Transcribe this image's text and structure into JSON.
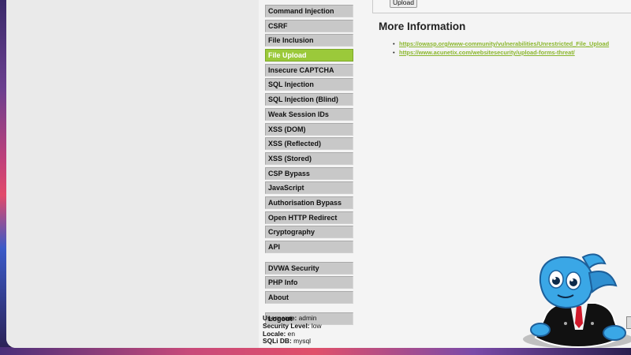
{
  "menu": {
    "group1": [
      {
        "label": "Command Injection",
        "selected": false
      },
      {
        "label": "CSRF",
        "selected": false
      },
      {
        "label": "File Inclusion",
        "selected": false
      },
      {
        "label": "File Upload",
        "selected": true
      },
      {
        "label": "Insecure CAPTCHA",
        "selected": false
      },
      {
        "label": "SQL Injection",
        "selected": false
      },
      {
        "label": "SQL Injection (Blind)",
        "selected": false
      },
      {
        "label": "Weak Session IDs",
        "selected": false
      },
      {
        "label": "XSS (DOM)",
        "selected": false
      },
      {
        "label": "XSS (Reflected)",
        "selected": false
      },
      {
        "label": "XSS (Stored)",
        "selected": false
      },
      {
        "label": "CSP Bypass",
        "selected": false
      },
      {
        "label": "JavaScript",
        "selected": false
      },
      {
        "label": "Authorisation Bypass",
        "selected": false
      },
      {
        "label": "Open HTTP Redirect",
        "selected": false
      },
      {
        "label": "Cryptography",
        "selected": false
      },
      {
        "label": "API",
        "selected": false
      }
    ],
    "group2": [
      {
        "label": "DVWA Security"
      },
      {
        "label": "PHP Info"
      },
      {
        "label": "About"
      }
    ],
    "logout": "Logout"
  },
  "userinfo": {
    "username_label": "Username:",
    "username": "admin",
    "security_label": "Security Level:",
    "security": "low",
    "locale_label": "Locale:",
    "locale": "en",
    "sqli_label": "SQLi DB:",
    "sqli": "mysql"
  },
  "main": {
    "upload_button": "Upload",
    "more_info_title": "More Information",
    "links": [
      "https://owasp.org/www-community/vulnerabilities/Unrestricted_File_Upload",
      "https://www.acunetix.com/websitesecurity/upload-forms-threat/"
    ]
  },
  "colors": {
    "selected_menu": "#9bc93a",
    "link": "#8ab62c"
  },
  "icons": [
    "mascot-sticker"
  ]
}
